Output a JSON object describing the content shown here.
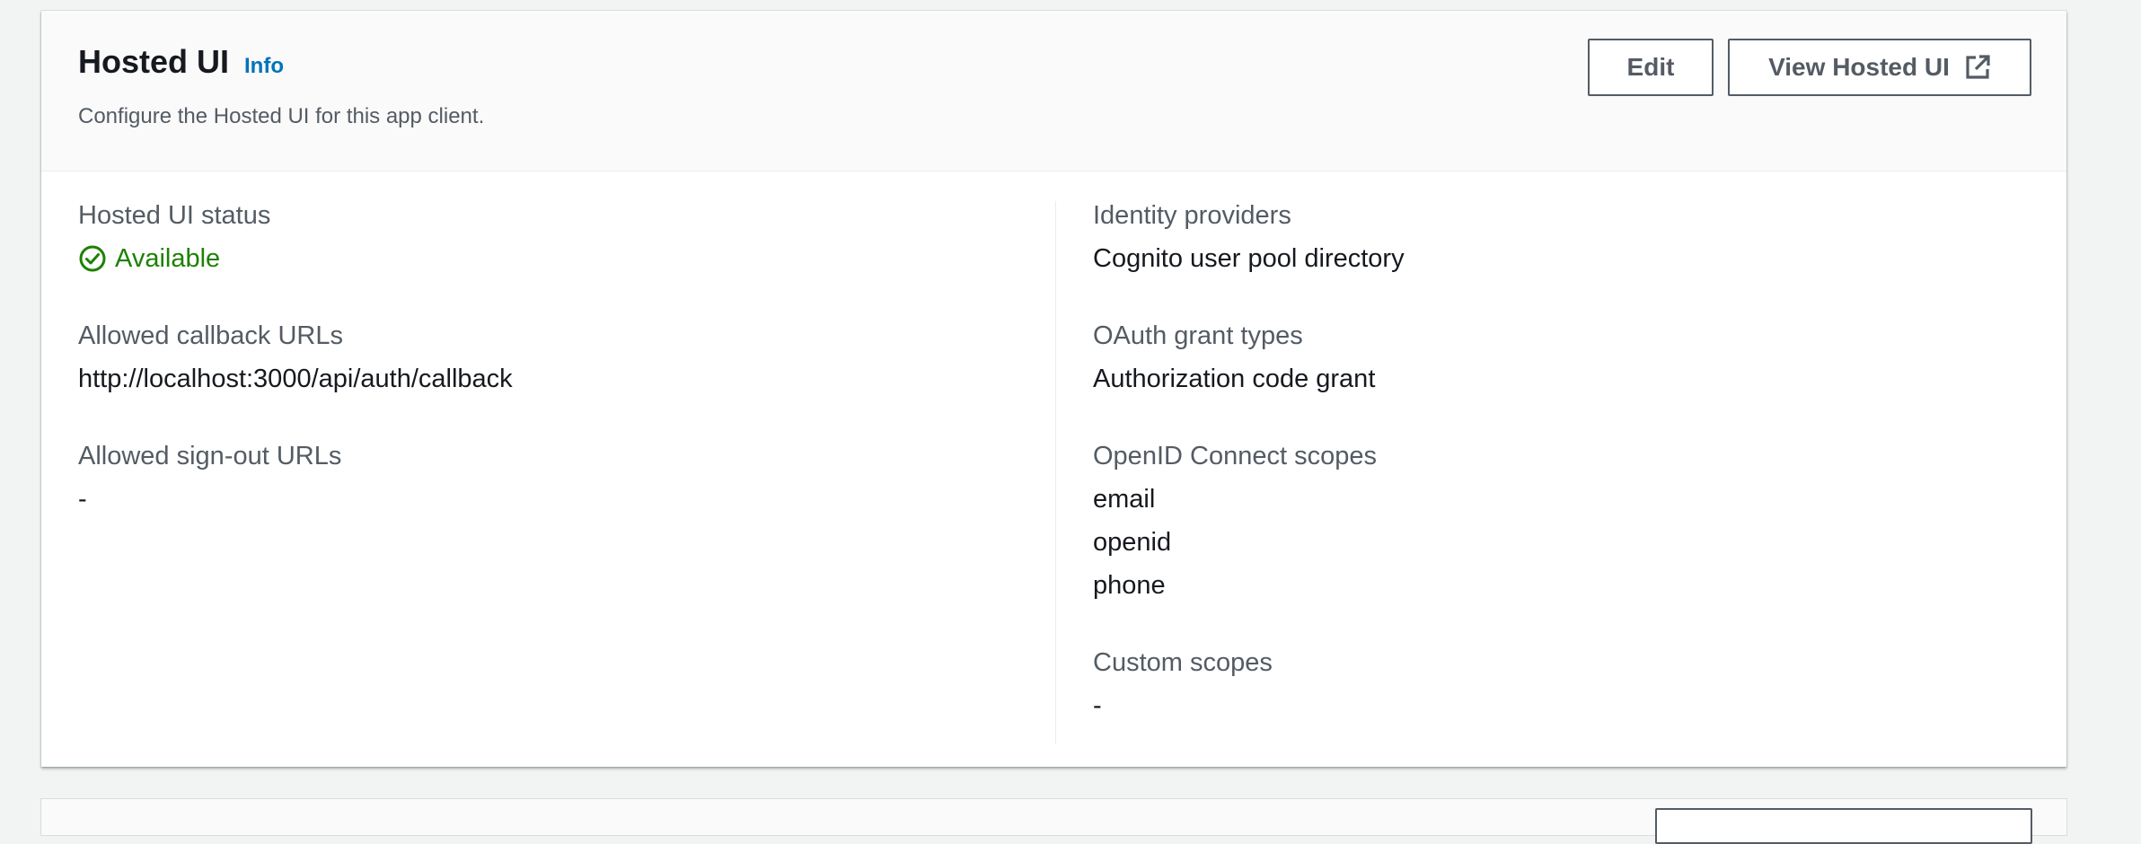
{
  "header": {
    "title": "Hosted UI",
    "info_link": "Info",
    "description": "Configure the Hosted UI for this app client.",
    "edit_label": "Edit",
    "view_hosted_ui_label": "View Hosted UI"
  },
  "left_fields": {
    "status": {
      "label": "Hosted UI status",
      "value": "Available"
    },
    "callback_urls": {
      "label": "Allowed callback URLs",
      "value": "http://localhost:3000/api/auth/callback"
    },
    "signout_urls": {
      "label": "Allowed sign-out URLs",
      "value": "-"
    }
  },
  "right_fields": {
    "identity_providers": {
      "label": "Identity providers",
      "value": "Cognito user pool directory"
    },
    "oauth_grant_types": {
      "label": "OAuth grant types",
      "value": "Authorization code grant"
    },
    "openid_scopes": {
      "label": "OpenID Connect scopes",
      "values": [
        "email",
        "openid",
        "phone"
      ]
    },
    "custom_scopes": {
      "label": "Custom scopes",
      "value": "-"
    }
  },
  "colors": {
    "link": "#0073bb",
    "success": "#1d8102",
    "label": "#545b64",
    "text": "#16191f"
  },
  "icons": {
    "external_link": "external-link-icon",
    "status_ok": "check-circle-icon"
  }
}
